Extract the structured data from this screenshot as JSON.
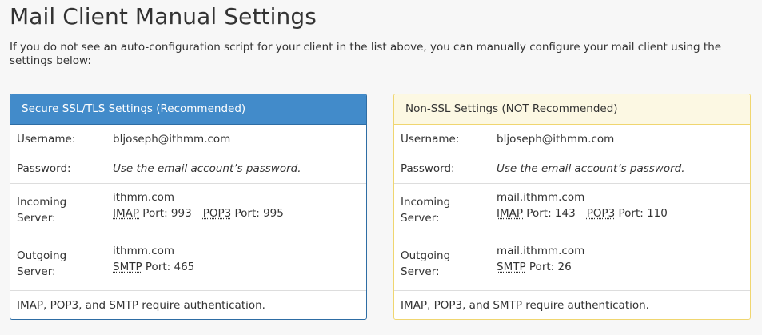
{
  "page": {
    "title": "Mail Client Manual Settings",
    "intro": "If you do not see an auto-configuration script for your client in the list above, you can manually configure your mail client using the settings below:"
  },
  "colors": {
    "ssl_heading_bg": "#428bca",
    "ssl_border": "#2e6da4",
    "nonssl_heading_bg": "#fcf8e3",
    "nonssl_border": "#f0d670"
  },
  "ssl": {
    "heading_prefix": "Secure ",
    "heading_ssl": "SSL",
    "heading_slash": "/",
    "heading_tls": "TLS",
    "heading_suffix": " Settings (Recommended)",
    "username_label": "Username:",
    "username": "bljoseph@ithmm.com",
    "password_label": "Password:",
    "password": "Use the email account’s password.",
    "incoming_label": "Incoming Server:",
    "incoming_host": "ithmm.com",
    "imap_label": "IMAP",
    "imap_port": " Port: 993",
    "pop3_label": "POP3",
    "pop3_port": " Port: 995",
    "outgoing_label": "Outgoing Server:",
    "outgoing_host": "ithmm.com",
    "smtp_label": "SMTP",
    "smtp_port": " Port: 465",
    "auth_note": "IMAP, POP3, and SMTP require authentication."
  },
  "nonssl": {
    "heading": "Non-SSL Settings (NOT Recommended)",
    "username_label": "Username:",
    "username": "bljoseph@ithmm.com",
    "password_label": "Password:",
    "password": "Use the email account’s password.",
    "incoming_label": "Incoming Server:",
    "incoming_host": "mail.ithmm.com",
    "imap_label": "IMAP",
    "imap_port": " Port: 143",
    "pop3_label": "POP3",
    "pop3_port": " Port: 110",
    "outgoing_label": "Outgoing Server:",
    "outgoing_host": "mail.ithmm.com",
    "smtp_label": "SMTP",
    "smtp_port": " Port: 26",
    "auth_note": "IMAP, POP3, and SMTP require authentication."
  }
}
